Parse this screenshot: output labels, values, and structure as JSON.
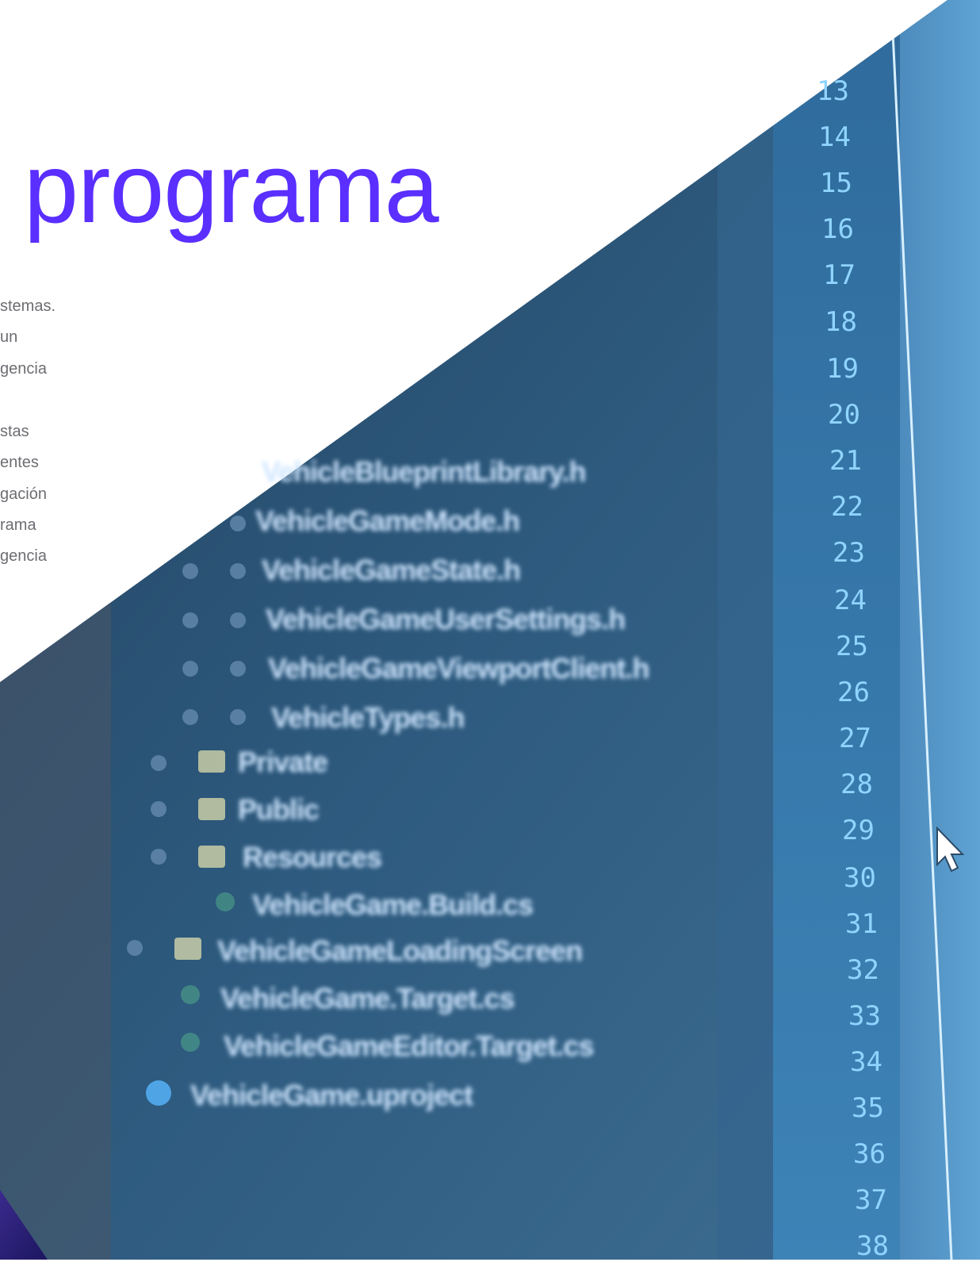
{
  "heading": {
    "title": "l programa"
  },
  "intro": {
    "lines": [
      "stemas.",
      "un",
      "gencia",
      "stas",
      "entes",
      "gación",
      "rama",
      "gencia"
    ]
  },
  "background": {
    "file_tree": [
      "VehicleBlueprintLibrary.h",
      "VehicleGameMode.h",
      "VehicleGameState.h",
      "VehicleGameUserSettings.h",
      "VehicleGameViewportClient.h",
      "VehicleTypes.h",
      "Private",
      "Public",
      "Resources",
      "VehicleGame.Build.cs",
      "VehicleGameLoadingScreen",
      "VehicleGame.Target.cs",
      "VehicleGameEditor.Target.cs",
      "VehicleGame.uproject"
    ],
    "line_numbers": [
      "13",
      "14",
      "15",
      "16",
      "17",
      "18",
      "19",
      "20",
      "21",
      "22",
      "23",
      "24",
      "25",
      "26",
      "27",
      "28",
      "29",
      "30",
      "31",
      "32",
      "33",
      "34",
      "35",
      "36",
      "37",
      "38"
    ]
  },
  "colors": {
    "accent": "#5a2fff",
    "body_text": "#6d6d73",
    "code_bg": "#2c5578",
    "line_numbers": "#8fd4ff"
  },
  "icons": {
    "pointer": "mouse-pointer-icon"
  }
}
